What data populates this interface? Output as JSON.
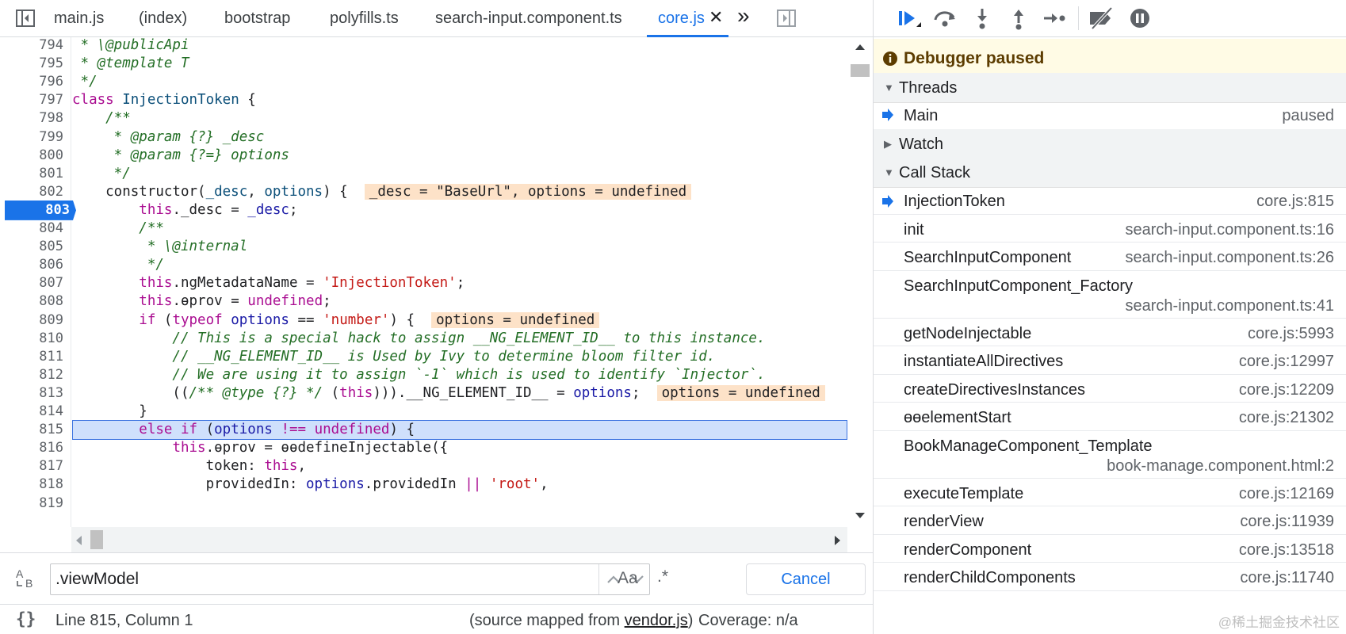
{
  "tabs": [
    {
      "label": "main.js",
      "active": false
    },
    {
      "label": "(index)",
      "active": false
    },
    {
      "label": "bootstrap",
      "active": false
    },
    {
      "label": "polyfills.ts",
      "active": false
    },
    {
      "label": "search-input.component.ts",
      "active": false
    },
    {
      "label": "core.js",
      "active": true
    }
  ],
  "tab_close_glyph": "✕",
  "tab_overflow_glyph": "»",
  "editor": {
    "lines": [
      {
        "n": "794",
        "html": "<span class='c-com'> * \\@publicApi</span>"
      },
      {
        "n": "795",
        "html": "<span class='c-com'> * @template T</span>"
      },
      {
        "n": "796",
        "html": "<span class='c-com'> */</span>"
      },
      {
        "n": "797",
        "html": "<span class='c-kw'>class</span> <span class='c-def'>InjectionToken</span> {"
      },
      {
        "n": "798",
        "html": "    <span class='c-com'>/**</span>"
      },
      {
        "n": "799",
        "html": "<span class='c-com'>     * @param {?} _desc</span>"
      },
      {
        "n": "800",
        "html": "<span class='c-com'>     * @param {?=} options</span>"
      },
      {
        "n": "801",
        "html": "<span class='c-com'>     */</span>"
      },
      {
        "n": "802",
        "html": "    constructor(<span class='c-def'>_desc</span>, <span class='c-def'>options</span>) {  <span class='inline-val'>_desc = \"BaseUrl\", options = undefined</span>"
      },
      {
        "n": "803",
        "html": "        <span class='c-kw'>this</span>._desc = <span class='c-var'>_desc</span>;",
        "breakpoint": true
      },
      {
        "n": "804",
        "html": "        <span class='c-com'>/**</span>"
      },
      {
        "n": "805",
        "html": "<span class='c-com'>         * \\@internal</span>"
      },
      {
        "n": "806",
        "html": "<span class='c-com'>         */</span>"
      },
      {
        "n": "807",
        "html": "        <span class='c-kw'>this</span>.ngMetadataName = <span class='c-str'>'InjectionToken'</span>;"
      },
      {
        "n": "808",
        "html": "        <span class='c-kw'>this</span>.ɵprov = <span class='c-kw'>undefined</span>;"
      },
      {
        "n": "809",
        "html": "        <span class='c-kw'>if</span> (<span class='c-kw'>typeof</span> <span class='c-var'>options</span> == <span class='c-str'>'number'</span>) {  <span class='inline-val'>options = undefined</span>"
      },
      {
        "n": "810",
        "html": "<span class='c-com'>            // This is a special hack to assign __NG_ELEMENT_ID__ to this instance.</span>"
      },
      {
        "n": "811",
        "html": "<span class='c-com'>            // __NG_ELEMENT_ID__ is Used by Ivy to determine bloom filter id.</span>"
      },
      {
        "n": "812",
        "html": "<span class='c-com'>            // We are using it to assign `-1` which is used to identify `Injector`.</span>"
      },
      {
        "n": "813",
        "html": "            ((<span class='c-com'>/** @type {?} */</span> (<span class='c-kw'>this</span>))).__NG_ELEMENT_ID__ = <span class='c-var'>options</span>;  <span class='inline-val'>options = undefined</span>"
      },
      {
        "n": "814",
        "html": "        }"
      },
      {
        "n": "815",
        "html": "        <span class='c-kw'>else if</span> (<span class='c-var'>options</span> <span class='c-kw'>!==</span> <span class='c-kw'>undefined</span>) {",
        "exec": true
      },
      {
        "n": "816",
        "html": "            <span class='c-kw'>this</span>.ɵprov = ɵɵdefineInjectable({"
      },
      {
        "n": "817",
        "html": "                token: <span class='c-kw'>this</span>,"
      },
      {
        "n": "818",
        "html": "                providedIn: <span class='c-var'>options</span>.providedIn <span class='c-kw'>||</span> <span class='c-str'>'root'</span>,"
      },
      {
        "n": "819",
        "html": ""
      }
    ]
  },
  "search": {
    "value": ".viewModel",
    "case_label": "Aa",
    "regex_label": ".*",
    "cancel_label": "Cancel"
  },
  "status": {
    "position": "Line 815, Column 1",
    "source_mapped_prefix": "(source mapped from ",
    "source_mapped_link": "vendor.js",
    "source_mapped_suffix": ")",
    "coverage": "Coverage: n/a"
  },
  "debugger": {
    "paused_text": "Debugger paused",
    "threads": {
      "label": "Threads",
      "items": [
        {
          "name": "Main",
          "state": "paused"
        }
      ]
    },
    "watch_label": "Watch",
    "call_stack": {
      "label": "Call Stack",
      "frames": [
        {
          "fn": "InjectionToken",
          "loc": "core.js:815",
          "current": true
        },
        {
          "fn": "init",
          "loc": "search-input.component.ts:16"
        },
        {
          "fn": "SearchInputComponent",
          "loc": "search-input.component.ts:26"
        },
        {
          "fn": "SearchInputComponent_Factory",
          "loc": "search-input.component.ts:41",
          "wrap": true
        },
        {
          "fn": "getNodeInjectable",
          "loc": "core.js:5993"
        },
        {
          "fn": "instantiateAllDirectives",
          "loc": "core.js:12997"
        },
        {
          "fn": "createDirectivesInstances",
          "loc": "core.js:12209"
        },
        {
          "fn": "ɵɵelementStart",
          "loc": "core.js:21302"
        },
        {
          "fn": "BookManageComponent_Template",
          "loc": "book-manage.component.html:2",
          "wrap": true
        },
        {
          "fn": "executeTemplate",
          "loc": "core.js:12169"
        },
        {
          "fn": "renderView",
          "loc": "core.js:11939"
        },
        {
          "fn": "renderComponent",
          "loc": "core.js:13518"
        },
        {
          "fn": "renderChildComponents",
          "loc": "core.js:11740"
        }
      ]
    }
  },
  "watermark": "@稀土掘金技术社区",
  "colors": {
    "accent": "#1a73e8",
    "exec_line_bg": "#cfe0fc",
    "paused_banner_bg": "#fffbe5",
    "inline_value_bg": "#fde2c8"
  }
}
